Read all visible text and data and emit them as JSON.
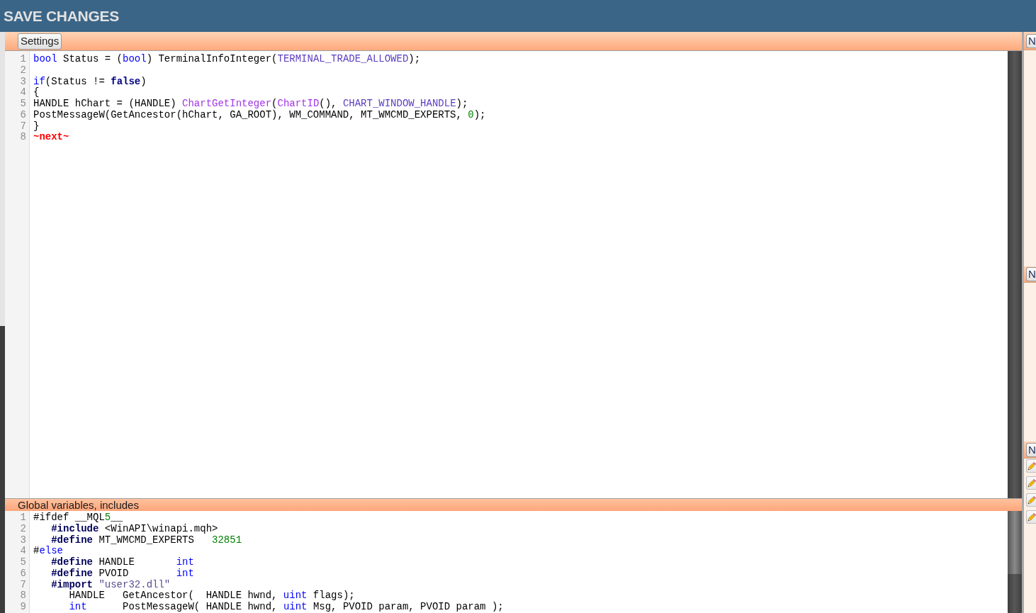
{
  "top_bar": {
    "title": "SAVE CHANGES"
  },
  "editor": {
    "toolbar_button": "Settings",
    "lines": [
      {
        "number": "1",
        "tokens": [
          {
            "kind": "type",
            "text": "bool"
          },
          {
            "kind": "plain",
            "text": " Status = ("
          },
          {
            "kind": "type",
            "text": "bool"
          },
          {
            "kind": "plain",
            "text": ") TerminalInfoInteger("
          },
          {
            "kind": "constant",
            "text": "TERMINAL_TRADE_ALLOWED"
          },
          {
            "kind": "plain",
            "text": ");"
          }
        ]
      },
      {
        "number": "2"
      },
      {
        "number": "3",
        "tokens": [
          {
            "kind": "keyword",
            "text": "if"
          },
          {
            "kind": "plain",
            "text": "(Status != "
          },
          {
            "kind": "literal",
            "text": "false"
          },
          {
            "kind": "plain",
            "text": ")"
          }
        ]
      },
      {
        "number": "4",
        "tokens": [
          {
            "kind": "plain",
            "text": "{"
          }
        ]
      },
      {
        "number": "5",
        "tokens": [
          {
            "kind": "plain",
            "text": "HANDLE hChart = (HANDLE) "
          },
          {
            "kind": "function",
            "text": "ChartGetInteger"
          },
          {
            "kind": "plain",
            "text": "("
          },
          {
            "kind": "function",
            "text": "ChartID"
          },
          {
            "kind": "plain",
            "text": "(), "
          },
          {
            "kind": "constant",
            "text": "CHART_WINDOW_HANDLE"
          },
          {
            "kind": "plain",
            "text": ");"
          }
        ]
      },
      {
        "number": "6",
        "tokens": [
          {
            "kind": "plain",
            "text": "PostMessageW(GetAncestor(hChart, GA_ROOT), WM_COMMAND, MT_WMCMD_EXPERTS, "
          },
          {
            "kind": "number",
            "text": "0"
          },
          {
            "kind": "plain",
            "text": ");"
          }
        ]
      },
      {
        "number": "7",
        "tokens": [
          {
            "kind": "plain",
            "text": "}"
          }
        ]
      },
      {
        "number": "8",
        "tokens": [
          {
            "kind": "marker",
            "text": "~next~"
          }
        ]
      }
    ]
  },
  "globals_section": {
    "title": "Global variables, includes",
    "lines": [
      {
        "number": "1",
        "tokens": [
          {
            "kind": "plain",
            "text": "#ifdef __MQL"
          },
          {
            "kind": "number",
            "text": "5"
          },
          {
            "kind": "plain",
            "text": "__"
          }
        ]
      },
      {
        "number": "2",
        "tokens": [
          {
            "kind": "directive",
            "text": "   #include"
          },
          {
            "kind": "plain",
            "text": " <WinAPI\\winapi.mqh>"
          }
        ]
      },
      {
        "number": "3",
        "tokens": [
          {
            "kind": "directive",
            "text": "   #define"
          },
          {
            "kind": "plain",
            "text": " MT_WMCMD_EXPERTS   "
          },
          {
            "kind": "number",
            "text": "32851"
          }
        ]
      },
      {
        "number": "4",
        "tokens": [
          {
            "kind": "plain",
            "text": "#"
          },
          {
            "kind": "keyword",
            "text": "else"
          }
        ]
      },
      {
        "number": "5",
        "tokens": [
          {
            "kind": "directive",
            "text": "   #define"
          },
          {
            "kind": "plain",
            "text": " HANDLE       "
          },
          {
            "kind": "type",
            "text": "int"
          }
        ]
      },
      {
        "number": "6",
        "tokens": [
          {
            "kind": "directive",
            "text": "   #define"
          },
          {
            "kind": "plain",
            "text": " PVOID        "
          },
          {
            "kind": "type",
            "text": "int"
          }
        ]
      },
      {
        "number": "7",
        "tokens": [
          {
            "kind": "directive",
            "text": "   #import"
          },
          {
            "kind": "string",
            "text": " \"user32.dll\""
          }
        ]
      },
      {
        "number": "8",
        "tokens": [
          {
            "kind": "plain",
            "text": "      HANDLE   GetAncestor(  HANDLE hwnd, "
          },
          {
            "kind": "type",
            "text": "uint"
          },
          {
            "kind": "plain",
            "text": " flags);"
          }
        ]
      },
      {
        "number": "9",
        "tokens": [
          {
            "kind": "type",
            "text": "      int"
          },
          {
            "kind": "plain",
            "text": "      PostMessageW( HANDLE hwnd, "
          },
          {
            "kind": "type",
            "text": "uint"
          },
          {
            "kind": "plain",
            "text": " Msg, PVOID param, PVOID param );"
          }
        ]
      }
    ]
  },
  "right_panel": {
    "sections": [
      {
        "button": "N"
      },
      {
        "button": "N"
      },
      {
        "button": "N"
      }
    ],
    "tools": [
      {
        "kind": "edit"
      },
      {
        "kind": "edit"
      },
      {
        "kind": "edit"
      },
      {
        "kind": "edit"
      }
    ]
  }
}
